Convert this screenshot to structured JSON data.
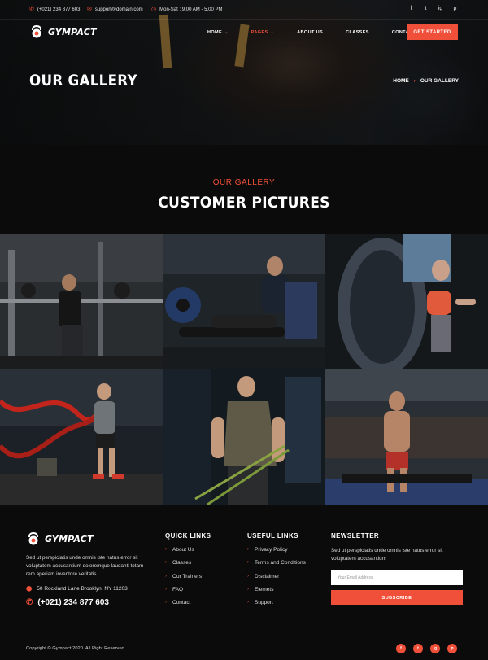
{
  "topbar": {
    "phone": "(+021) 234 877 603",
    "email": "support@domain.com",
    "hours": "Mon-Sat : 9.00 AM - 5.00 PM",
    "social": [
      "f",
      "t",
      "ig",
      "p"
    ]
  },
  "brand": {
    "name": "GYMPACT"
  },
  "nav": {
    "items": [
      {
        "label": "HOME",
        "dropdown": true
      },
      {
        "label": "PAGES",
        "dropdown": true,
        "active": true
      },
      {
        "label": "ABOUT US",
        "dropdown": false
      },
      {
        "label": "CLASSES",
        "dropdown": false
      },
      {
        "label": "CONTACT",
        "dropdown": true
      }
    ],
    "cta": "GET STARTED"
  },
  "hero": {
    "title": "OUR GALLERY",
    "breadcrumb": [
      "HOME",
      "OUR GALLERY"
    ]
  },
  "section": {
    "subtitle": "OUR GALLERY",
    "title": "CUSTOMER PICTURES"
  },
  "gallery": {
    "photos": [
      "squat-rack",
      "leg-curl-machine",
      "treadmill-woman",
      "battle-ropes",
      "resistance-bands",
      "treadmill-man"
    ]
  },
  "footer": {
    "about": "Sed ut perspiciatis unde omnis iste natus error sit voluptatem accusantium doloremque laudanti totam rem aperiam inventore veritatis",
    "address": "50 Rockland Lane Brooklyn, NY 11203",
    "phone": "(+021) 234 877 603",
    "quick_links": {
      "title": "QUICK LINKS",
      "items": [
        "About Us",
        "Classes",
        "Our Trainers",
        "FAQ",
        "Contact"
      ]
    },
    "useful_links": {
      "title": "USEFUL LINKS",
      "items": [
        "Privacy Policy",
        "Terms and Conditions",
        "Disclaimer",
        "Elemets",
        "Support"
      ]
    },
    "newsletter": {
      "title": "NEWSLETTER",
      "text": "Sed ut perspiciatis unde omnis iste natus error sit voluptatem accusantium",
      "placeholder": "Your Email Address",
      "button": "SUBSCRIBE"
    },
    "copyright": "Copyright © Gympact 2020. All Right Reserved.",
    "social": [
      "f",
      "t",
      "ig",
      "p"
    ]
  },
  "colors": {
    "accent": "#f0503a",
    "background": "#0b0b0b"
  }
}
